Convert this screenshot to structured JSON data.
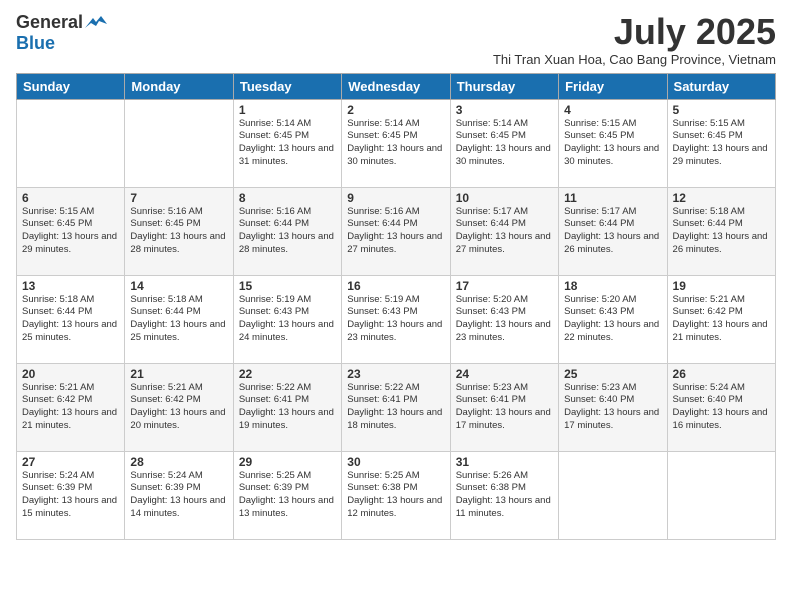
{
  "logo": {
    "general": "General",
    "blue": "Blue"
  },
  "title": "July 2025",
  "subtitle": "Thi Tran Xuan Hoa, Cao Bang Province, Vietnam",
  "headers": [
    "Sunday",
    "Monday",
    "Tuesday",
    "Wednesday",
    "Thursday",
    "Friday",
    "Saturday"
  ],
  "weeks": [
    [
      {
        "day": "",
        "info": ""
      },
      {
        "day": "",
        "info": ""
      },
      {
        "day": "1",
        "info": "Sunrise: 5:14 AM\nSunset: 6:45 PM\nDaylight: 13 hours and 31 minutes."
      },
      {
        "day": "2",
        "info": "Sunrise: 5:14 AM\nSunset: 6:45 PM\nDaylight: 13 hours and 30 minutes."
      },
      {
        "day": "3",
        "info": "Sunrise: 5:14 AM\nSunset: 6:45 PM\nDaylight: 13 hours and 30 minutes."
      },
      {
        "day": "4",
        "info": "Sunrise: 5:15 AM\nSunset: 6:45 PM\nDaylight: 13 hours and 30 minutes."
      },
      {
        "day": "5",
        "info": "Sunrise: 5:15 AM\nSunset: 6:45 PM\nDaylight: 13 hours and 29 minutes."
      }
    ],
    [
      {
        "day": "6",
        "info": "Sunrise: 5:15 AM\nSunset: 6:45 PM\nDaylight: 13 hours and 29 minutes."
      },
      {
        "day": "7",
        "info": "Sunrise: 5:16 AM\nSunset: 6:45 PM\nDaylight: 13 hours and 28 minutes."
      },
      {
        "day": "8",
        "info": "Sunrise: 5:16 AM\nSunset: 6:44 PM\nDaylight: 13 hours and 28 minutes."
      },
      {
        "day": "9",
        "info": "Sunrise: 5:16 AM\nSunset: 6:44 PM\nDaylight: 13 hours and 27 minutes."
      },
      {
        "day": "10",
        "info": "Sunrise: 5:17 AM\nSunset: 6:44 PM\nDaylight: 13 hours and 27 minutes."
      },
      {
        "day": "11",
        "info": "Sunrise: 5:17 AM\nSunset: 6:44 PM\nDaylight: 13 hours and 26 minutes."
      },
      {
        "day": "12",
        "info": "Sunrise: 5:18 AM\nSunset: 6:44 PM\nDaylight: 13 hours and 26 minutes."
      }
    ],
    [
      {
        "day": "13",
        "info": "Sunrise: 5:18 AM\nSunset: 6:44 PM\nDaylight: 13 hours and 25 minutes."
      },
      {
        "day": "14",
        "info": "Sunrise: 5:18 AM\nSunset: 6:44 PM\nDaylight: 13 hours and 25 minutes."
      },
      {
        "day": "15",
        "info": "Sunrise: 5:19 AM\nSunset: 6:43 PM\nDaylight: 13 hours and 24 minutes."
      },
      {
        "day": "16",
        "info": "Sunrise: 5:19 AM\nSunset: 6:43 PM\nDaylight: 13 hours and 23 minutes."
      },
      {
        "day": "17",
        "info": "Sunrise: 5:20 AM\nSunset: 6:43 PM\nDaylight: 13 hours and 23 minutes."
      },
      {
        "day": "18",
        "info": "Sunrise: 5:20 AM\nSunset: 6:43 PM\nDaylight: 13 hours and 22 minutes."
      },
      {
        "day": "19",
        "info": "Sunrise: 5:21 AM\nSunset: 6:42 PM\nDaylight: 13 hours and 21 minutes."
      }
    ],
    [
      {
        "day": "20",
        "info": "Sunrise: 5:21 AM\nSunset: 6:42 PM\nDaylight: 13 hours and 21 minutes."
      },
      {
        "day": "21",
        "info": "Sunrise: 5:21 AM\nSunset: 6:42 PM\nDaylight: 13 hours and 20 minutes."
      },
      {
        "day": "22",
        "info": "Sunrise: 5:22 AM\nSunset: 6:41 PM\nDaylight: 13 hours and 19 minutes."
      },
      {
        "day": "23",
        "info": "Sunrise: 5:22 AM\nSunset: 6:41 PM\nDaylight: 13 hours and 18 minutes."
      },
      {
        "day": "24",
        "info": "Sunrise: 5:23 AM\nSunset: 6:41 PM\nDaylight: 13 hours and 17 minutes."
      },
      {
        "day": "25",
        "info": "Sunrise: 5:23 AM\nSunset: 6:40 PM\nDaylight: 13 hours and 17 minutes."
      },
      {
        "day": "26",
        "info": "Sunrise: 5:24 AM\nSunset: 6:40 PM\nDaylight: 13 hours and 16 minutes."
      }
    ],
    [
      {
        "day": "27",
        "info": "Sunrise: 5:24 AM\nSunset: 6:39 PM\nDaylight: 13 hours and 15 minutes."
      },
      {
        "day": "28",
        "info": "Sunrise: 5:24 AM\nSunset: 6:39 PM\nDaylight: 13 hours and 14 minutes."
      },
      {
        "day": "29",
        "info": "Sunrise: 5:25 AM\nSunset: 6:39 PM\nDaylight: 13 hours and 13 minutes."
      },
      {
        "day": "30",
        "info": "Sunrise: 5:25 AM\nSunset: 6:38 PM\nDaylight: 13 hours and 12 minutes."
      },
      {
        "day": "31",
        "info": "Sunrise: 5:26 AM\nSunset: 6:38 PM\nDaylight: 13 hours and 11 minutes."
      },
      {
        "day": "",
        "info": ""
      },
      {
        "day": "",
        "info": ""
      }
    ]
  ]
}
